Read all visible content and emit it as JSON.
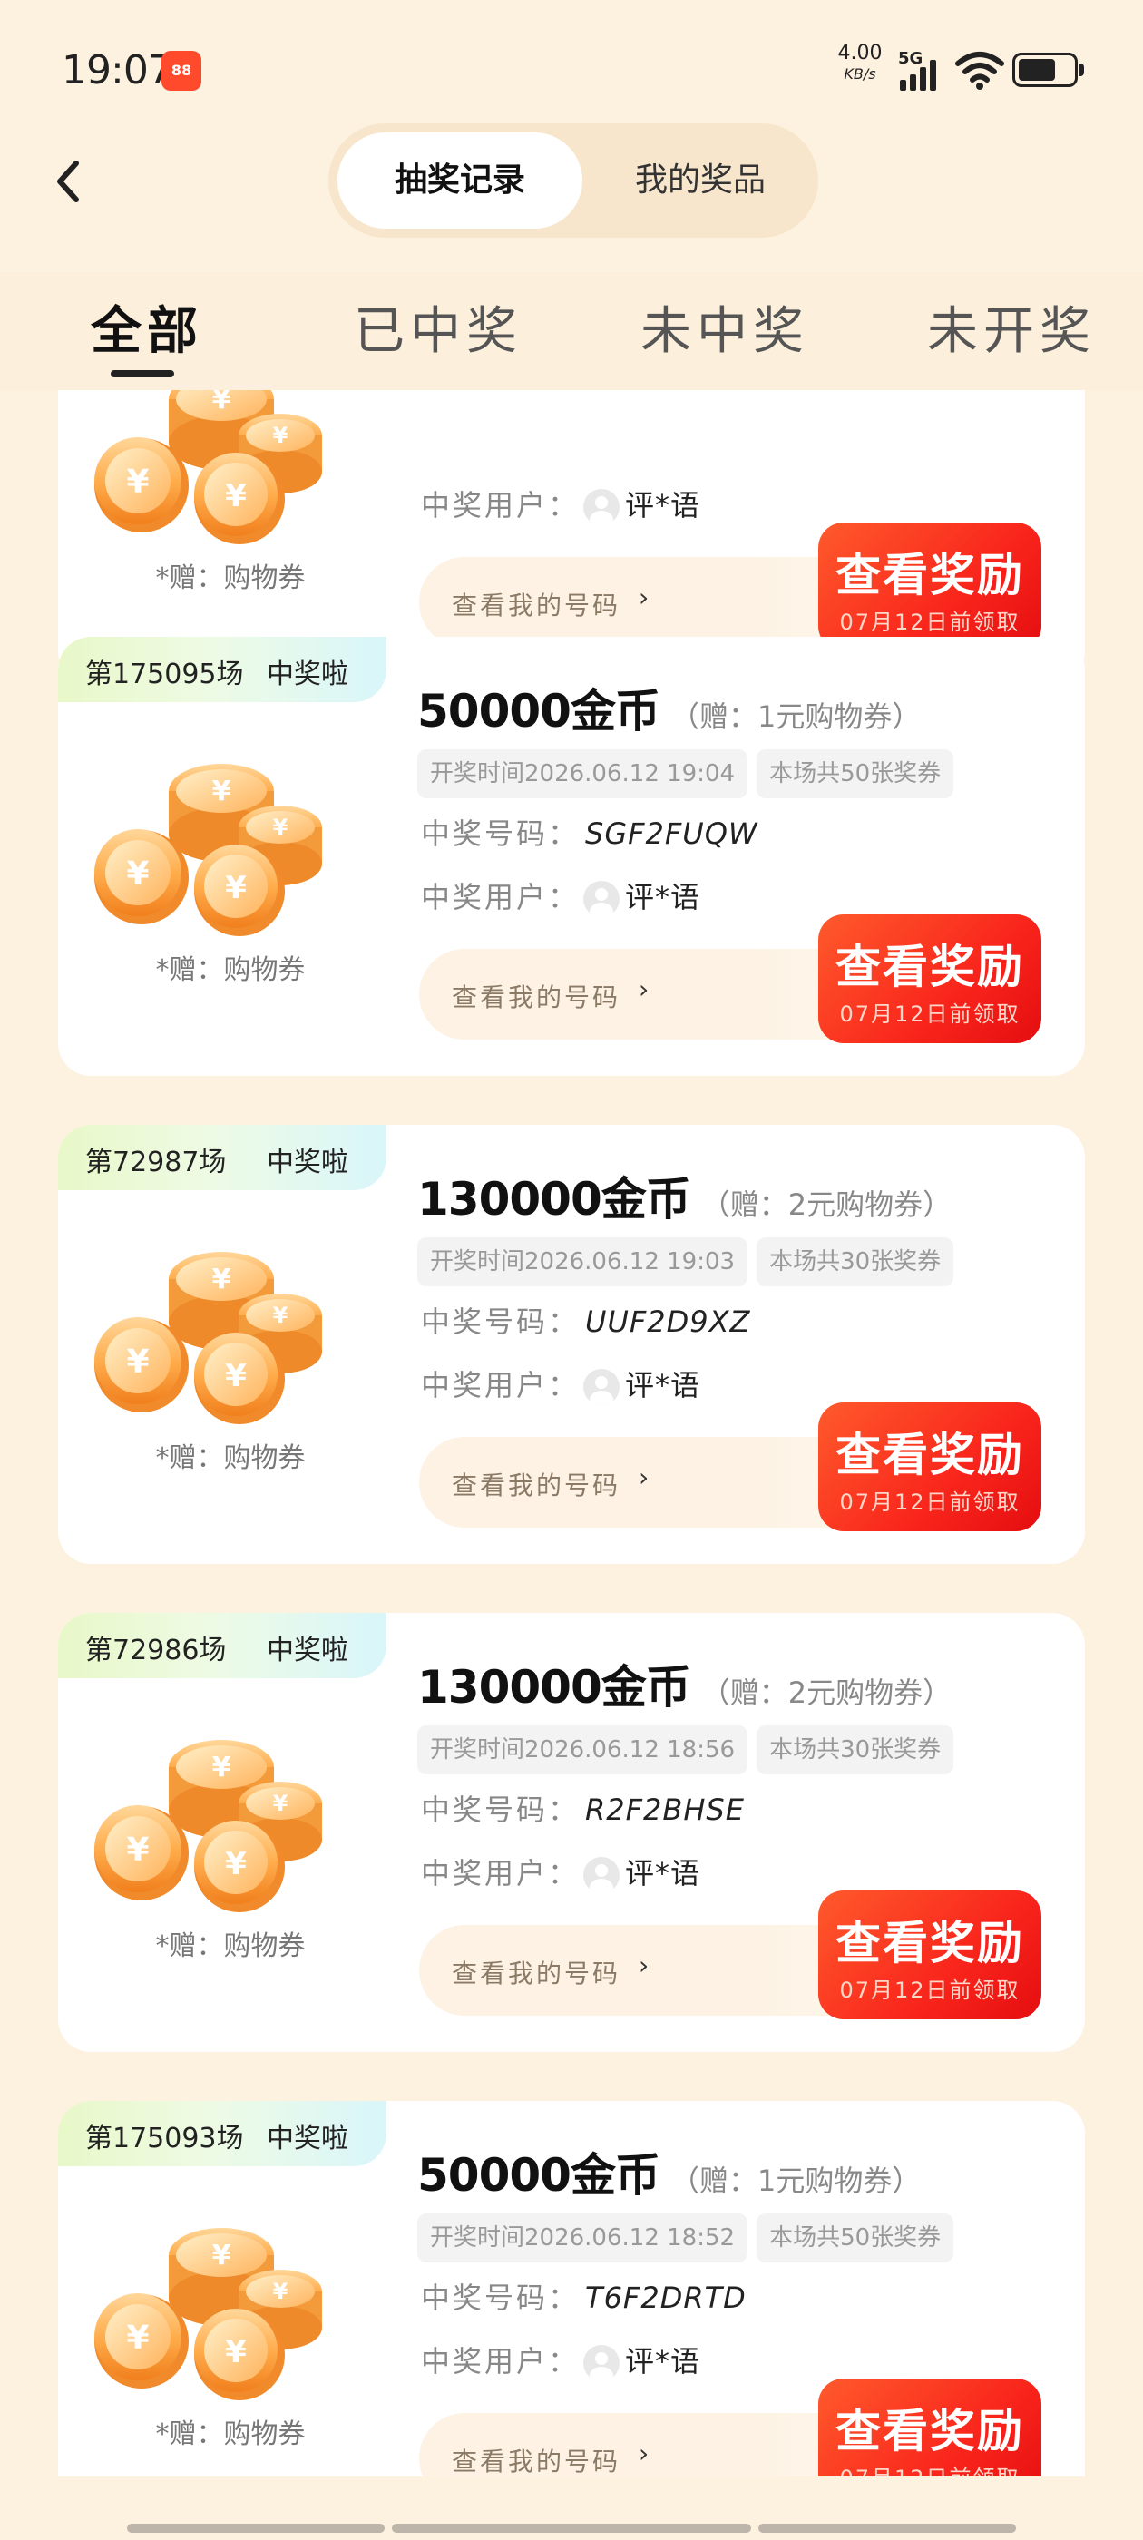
{
  "status_bar": {
    "time": "19:07",
    "app_badge": "88",
    "net_speed_value": "4.00",
    "net_speed_unit": "KB/s",
    "network": "5G",
    "icons": [
      "signal-icon",
      "wifi-icon",
      "battery-icon"
    ]
  },
  "header": {
    "back_icon": "chevron-left-icon",
    "segments": [
      "抽奖记录",
      "我的奖品"
    ],
    "active_segment": "抽奖记录"
  },
  "filter_tabs": {
    "items": [
      "全部",
      "已中奖",
      "未中奖",
      "未开奖"
    ],
    "active": "全部"
  },
  "labels": {
    "winner_code": "中奖号码：",
    "winner_user": "中奖用户：",
    "my_code": "查看我的号码",
    "reward_button": "查看奖励",
    "reward_deadline": "07月12日前领取",
    "gift_note": "*赠：购物券",
    "won_tag": "中奖啦"
  },
  "records": [
    {
      "round": "",
      "prize": "",
      "gift": "",
      "draw_time": "",
      "ticket_total": "",
      "winner_code": "",
      "winner_user": "评*语"
    },
    {
      "round": "第175095场",
      "prize": "50000金币",
      "gift": "（赠：1元购物券）",
      "draw_time": "开奖时间2026.06.12 19:04",
      "ticket_total": "本场共50张奖券",
      "winner_code": "SGF2FUQW",
      "winner_user": "评*语"
    },
    {
      "round": "第72987场",
      "prize": "130000金币",
      "gift": "（赠：2元购物券）",
      "draw_time": "开奖时间2026.06.12 19:03",
      "ticket_total": "本场共30张奖券",
      "winner_code": "UUF2D9XZ",
      "winner_user": "评*语"
    },
    {
      "round": "第72986场",
      "prize": "130000金币",
      "gift": "（赠：2元购物券）",
      "draw_time": "开奖时间2026.06.12 18:56",
      "ticket_total": "本场共30张奖券",
      "winner_code": "R2F2BHSE",
      "winner_user": "评*语"
    },
    {
      "round": "第175093场",
      "prize": "50000金币",
      "gift": "（赠：1元购物券）",
      "draw_time": "开奖时间2026.06.12 18:52",
      "ticket_total": "本场共50张奖券",
      "winner_code": "T6F2DRTD",
      "winner_user": "评*语"
    }
  ],
  "colors": {
    "background": "#fdf1df",
    "accent_red": "#f9261c",
    "card": "#ffffff",
    "tag_gradient_start": "#e8f8c8",
    "tag_gradient_end": "#d9f6fa"
  }
}
